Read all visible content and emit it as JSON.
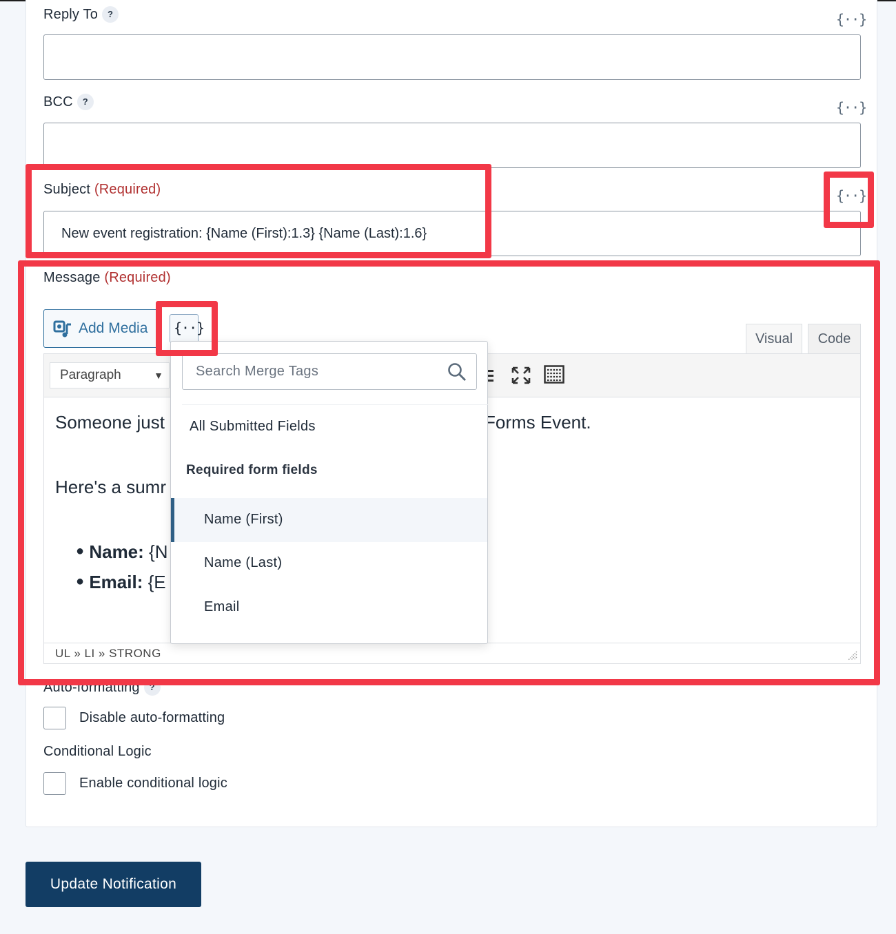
{
  "fields": {
    "reply_to": {
      "label": "Reply To",
      "help": "?",
      "value": ""
    },
    "bcc": {
      "label": "BCC",
      "help": "?",
      "value": ""
    },
    "subject": {
      "label": "Subject",
      "required": "(Required)",
      "value": "New event registration: {Name (First):1.3} {Name (Last):1.6}"
    },
    "message": {
      "label": "Message",
      "required": "(Required)"
    }
  },
  "merge_tag_icon": "{··}",
  "editor": {
    "add_media_label": "Add Media",
    "tabs": [
      "Visual",
      "Code"
    ],
    "format_select": "Paragraph",
    "content": {
      "line1_start": "Someone just",
      "line1_end": "Forms Event.",
      "line2_start": "Here's a sumr",
      "bullet1_label": "Name:",
      "bullet1_rest": "{N",
      "bullet2_label": "Email:",
      "bullet2_rest": "{E"
    },
    "path": "UL » LI » STRONG"
  },
  "merge_dropdown": {
    "search_placeholder": "Search Merge Tags",
    "all_fields": "All Submitted Fields",
    "group_label": "Required form fields",
    "items": [
      "Name (First)",
      "Name (Last)",
      "Email"
    ]
  },
  "auto_formatting": {
    "label": "Auto-formatting",
    "help": "?",
    "checkbox_label": "Disable auto-formatting"
  },
  "conditional_logic": {
    "label": "Conditional Logic",
    "checkbox_label": "Enable conditional logic"
  },
  "update_button": "Update Notification",
  "colors": {
    "highlight": "#f23847",
    "primary": "#123d64",
    "required": "#b13131"
  }
}
